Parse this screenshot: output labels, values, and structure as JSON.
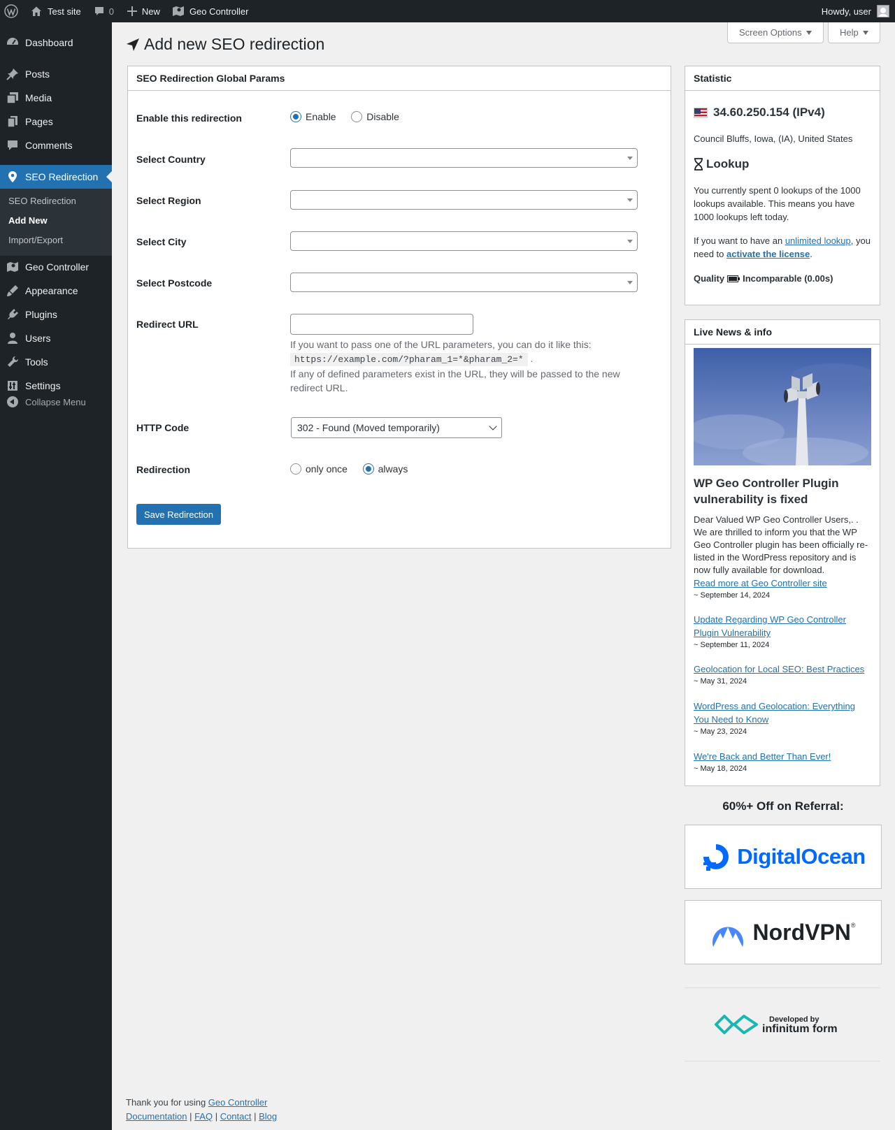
{
  "adminbar": {
    "site_name": "Test site",
    "comments_count": "0",
    "new_label": "New",
    "geo_controller_label": "Geo Controller",
    "howdy": "Howdy, user"
  },
  "sidebar": {
    "items": [
      {
        "label": "Dashboard",
        "icon": "dashboard-icon"
      },
      {
        "label": "Posts",
        "icon": "pin-icon"
      },
      {
        "label": "Media",
        "icon": "media-icon"
      },
      {
        "label": "Pages",
        "icon": "pages-icon"
      },
      {
        "label": "Comments",
        "icon": "comment-icon"
      },
      {
        "label": "SEO Redirection",
        "icon": "location-icon"
      },
      {
        "label": "Geo Controller",
        "icon": "map-icon"
      },
      {
        "label": "Appearance",
        "icon": "brush-icon"
      },
      {
        "label": "Plugins",
        "icon": "plug-icon"
      },
      {
        "label": "Users",
        "icon": "user-icon"
      },
      {
        "label": "Tools",
        "icon": "wrench-icon"
      },
      {
        "label": "Settings",
        "icon": "settings-icon"
      }
    ],
    "submenu": [
      "SEO Redirection",
      "Add New",
      "Import/Export"
    ],
    "collapse_label": "Collapse Menu"
  },
  "screen_options_label": "Screen Options",
  "help_label": "Help",
  "page_title": "Add new SEO redirection",
  "form": {
    "box_title": "SEO Redirection Global Params",
    "enable_label": "Enable this redirection",
    "enable_option": "Enable",
    "disable_option": "Disable",
    "enable_selected": "Enable",
    "country_label": "Select Country",
    "region_label": "Select Region",
    "city_label": "Select City",
    "postcode_label": "Select Postcode",
    "redirect_url_label": "Redirect URL",
    "redirect_url_value": "",
    "desc_line1": "If you want to pass one of the URL parameters, you can do it like this:",
    "desc_code": "https://example.com/?pharam_1=*&pharam_2=*",
    "desc_dot": ".",
    "desc_line2": "If any of defined parameters exist in the URL, they will be passed to the new redirect URL.",
    "http_code_label": "HTTP Code",
    "http_code_value": "302 - Found (Moved temporarily)",
    "redirection_label": "Redirection",
    "once_option": "only once",
    "always_option": "always",
    "redirection_selected": "always",
    "save_button": "Save Redirection"
  },
  "statistic": {
    "title": "Statistic",
    "ip": "34.60.250.154 (IPv4)",
    "location": "Council Bluffs, Iowa, (IA), United States",
    "lookup_title": "Lookup",
    "lookup_text": "You currently spent 0 lookups of the 1000 lookups available. This means you have 1000 lookups left today.",
    "license_pre": "If you want to have an ",
    "license_link1": "unlimited lookup",
    "license_mid": ", you need to ",
    "license_link2": "activate the license",
    "license_post": ".",
    "quality_label": "Quality",
    "quality_value": "Incomparable (0.00s)"
  },
  "news": {
    "title": "Live News & info",
    "headline": "WP Geo Controller Plugin vulnerability is fixed",
    "excerpt": "Dear Valued WP Geo Controller Users,. . We are thrilled to inform you that the WP Geo Controller plugin has been officially re-listed in the WordPress repository and is now fully available for download.",
    "read_more": "Read more at Geo Controller site",
    "headline_date": "~ September 14, 2024",
    "items": [
      {
        "title": "Update Regarding WP Geo Controller Plugin Vulnerability",
        "date": "~ September 11, 2024"
      },
      {
        "title": "Geolocation for Local SEO: Best Practices",
        "date": "~ May 31, 2024"
      },
      {
        "title": "WordPress and Geolocation: Everything You Need to Know",
        "date": "~ May 23, 2024"
      },
      {
        "title": "We're Back and Better Than Ever!",
        "date": "~ May 18, 2024"
      }
    ]
  },
  "referral": {
    "title": "60%+ Off on Referral:",
    "digitalocean": "DigitalOcean",
    "nordvpn": "NordVPN",
    "developed_by": "Developed by",
    "infinitum": "infinitum form"
  },
  "footer": {
    "thanks": "Thank you for using ",
    "geo_controller_link": "Geo Controller",
    "links": [
      "Documentation",
      "FAQ",
      "Contact",
      "Blog"
    ],
    "sep": " | "
  },
  "colors": {
    "admin_dark": "#1d2327",
    "accent": "#2271b1",
    "background": "#f0f0f1"
  }
}
